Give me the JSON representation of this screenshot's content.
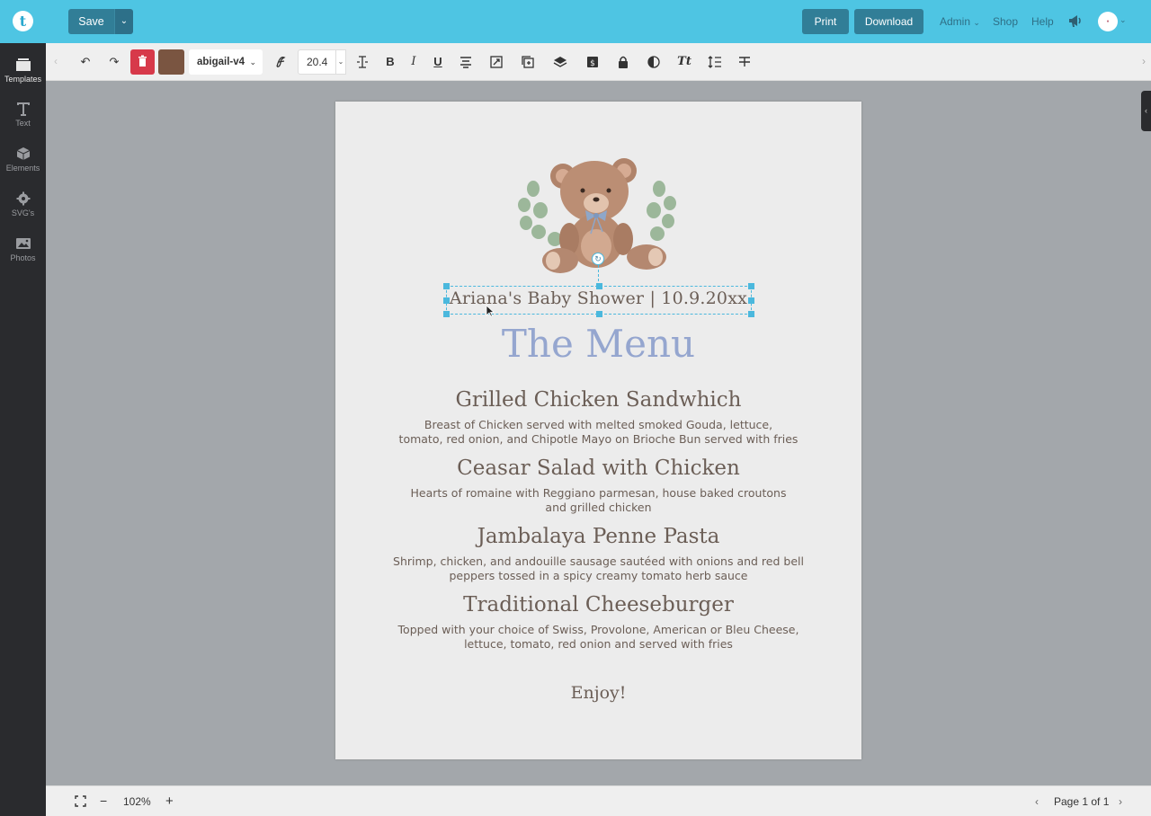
{
  "header": {
    "logo_letter": "t",
    "save_label": "Save",
    "print_label": "Print",
    "download_label": "Download",
    "admin_label": "Admin",
    "shop_label": "Shop",
    "help_label": "Help",
    "brand_color": "#4ec5e3",
    "button_color": "#317e97"
  },
  "sidebar": {
    "items": [
      {
        "label": "Templates",
        "icon": "templates-icon"
      },
      {
        "label": "Text",
        "icon": "text-icon"
      },
      {
        "label": "Elements",
        "icon": "elements-icon"
      },
      {
        "label": "SVG's",
        "icon": "svg-gear-icon"
      },
      {
        "label": "Photos",
        "icon": "photos-icon"
      }
    ]
  },
  "toolbar": {
    "font_name": "abigail-v4",
    "font_size": "20.4",
    "text_color": "#7a5541",
    "delete_color": "#d7394a"
  },
  "canvas": {
    "subtitle": "Ariana's Baby Shower | 10.9.20xx",
    "title": "The Menu",
    "items": [
      {
        "name": "Grilled Chicken Sandwhich",
        "desc1": "Breast of Chicken served with melted smoked Gouda, lettuce,",
        "desc2": "tomato, red onion, and Chipotle Mayo on Brioche Bun served with fries"
      },
      {
        "name": "Ceasar Salad with Chicken",
        "desc1": "Hearts of romaine with Reggiano parmesan, house baked croutons",
        "desc2": "and grilled chicken"
      },
      {
        "name": "Jambalaya Penne Pasta",
        "desc1": "Shrimp, chicken, and andouille sausage sautéed with onions and red bell",
        "desc2": "peppers tossed in a spicy creamy tomato herb sauce"
      },
      {
        "name": "Traditional Cheeseburger",
        "desc1": "Topped with your choice of Swiss, Provolone, American or Bleu Cheese,",
        "desc2": "lettuce, tomato, red onion and served with fries"
      }
    ],
    "closing": "Enjoy!",
    "title_color": "#95a6cf",
    "text_color": "#6b5e56"
  },
  "footer": {
    "zoom": "102%",
    "page_label": "Page 1 of 1"
  }
}
